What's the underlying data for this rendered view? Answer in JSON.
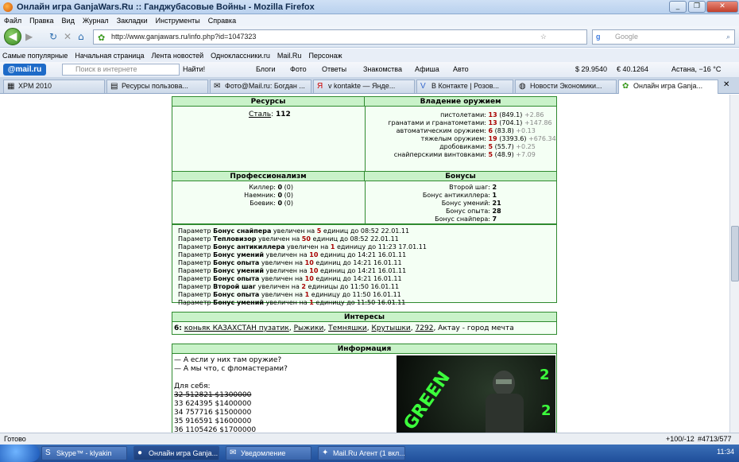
{
  "window": {
    "title": "Онлайн игра GanjaWars.Ru :: Ганджубасовые Войны - Mozilla Firefox"
  },
  "menu": [
    "Файл",
    "Правка",
    "Вид",
    "Журнал",
    "Закладки",
    "Инструменты",
    "Справка"
  ],
  "nav": {
    "url": "http://www.ganjawars.ru/info.php?id=1047323",
    "search_placeholder": "Google"
  },
  "bookmarks": [
    "Самые популярные",
    "Начальная страница",
    "Лента новостей",
    "Одноклассники.ru",
    "Mail.Ru",
    "Персонаж"
  ],
  "mailbar": {
    "logo": "@mail.ru",
    "search_placeholder": "Поиск в интернете",
    "find": "Найти!",
    "items": [
      "Блоги",
      "Фото",
      "Ответы",
      "Знакомства",
      "Афиша",
      "Авто"
    ],
    "usd": "$ 29.9540",
    "eur": "€ 40.1264",
    "weather": "Астана, −16 °C"
  },
  "tabs": [
    {
      "label": "XPM 2010",
      "icon": "grid-icon"
    },
    {
      "label": "Ресурсы пользова...",
      "icon": "page-icon"
    },
    {
      "label": "Фото@Mail.ru: Богдан ...",
      "icon": "mail-icon"
    },
    {
      "label": "v kontakte — Янде...",
      "icon": "yandex-icon"
    },
    {
      "label": "В Контакте | Розов...",
      "icon": "vk-icon"
    },
    {
      "label": "Новости Экономики...",
      "icon": "globe-icon"
    },
    {
      "label": "Онлайн игра Ganja...",
      "icon": "leaf-icon"
    }
  ],
  "resources": {
    "title": "Ресурсы",
    "steel_label": "Сталь",
    "steel_value": "112"
  },
  "weapons": {
    "title": "Владение оружием",
    "rows": [
      {
        "label": "пистолетами:",
        "level": "13",
        "exp": "(849.1)",
        "delta": "+2.86"
      },
      {
        "label": "гранатами и гранатометами:",
        "level": "13",
        "exp": "(704.1)",
        "delta": "+147.86"
      },
      {
        "label": "автоматическим оружием:",
        "level": "6",
        "exp": "(83.8)",
        "delta": "+0.13"
      },
      {
        "label": "тяжелым оружием:",
        "level": "19",
        "exp": "(3393.6)",
        "delta": "+676.34"
      },
      {
        "label": "дробовиками:",
        "level": "5",
        "exp": "(55.7)",
        "delta": "+0.25"
      },
      {
        "label": "снайперскими винтовками:",
        "level": "5",
        "exp": "(48.9)",
        "delta": "+7.09"
      }
    ]
  },
  "professions": {
    "title": "Профессионализм",
    "rows": [
      {
        "label": "Киллер:",
        "value": "0",
        "extra": "(0)"
      },
      {
        "label": "Наемник:",
        "value": "0",
        "extra": "(0)"
      },
      {
        "label": "Боевик:",
        "value": "0",
        "extra": "(0)"
      }
    ]
  },
  "bonuses": {
    "title": "Бонусы",
    "rows": [
      {
        "label": "Второй шаг:",
        "value": "2"
      },
      {
        "label": "Бонус антикиллера:",
        "value": "1"
      },
      {
        "label": "Бонус умений:",
        "value": "21"
      },
      {
        "label": "Бонус опыта:",
        "value": "28"
      },
      {
        "label": "Бонус снайпера:",
        "value": "7"
      }
    ]
  },
  "log": [
    {
      "pre": "Параметр",
      "param": "Бонус снайпера",
      "mid": "увеличен на",
      "amount": "5",
      "post": "единиц до 08:52 22.01.11"
    },
    {
      "pre": "Параметр",
      "param": "Тепловизор",
      "mid": "увеличен на",
      "amount": "50",
      "post": "единиц до 08:52 22.01.11"
    },
    {
      "pre": "Параметр",
      "param": "Бонус антикиллера",
      "mid": "увеличен на",
      "amount": "1",
      "post": "единицу до 11:23 17.01.11"
    },
    {
      "pre": "Параметр",
      "param": "Бонус умений",
      "mid": "увеличен на",
      "amount": "10",
      "post": "единиц до 14:21 16.01.11"
    },
    {
      "pre": "Параметр",
      "param": "Бонус опыта",
      "mid": "увеличен на",
      "amount": "10",
      "post": "единиц до 14:21 16.01.11"
    },
    {
      "pre": "Параметр",
      "param": "Бонус умений",
      "mid": "увеличен на",
      "amount": "10",
      "post": "единиц до 14:21 16.01.11"
    },
    {
      "pre": "Параметр",
      "param": "Бонус опыта",
      "mid": "увеличен на",
      "amount": "10",
      "post": "единиц до 14:21 16.01.11"
    },
    {
      "pre": "Параметр",
      "param": "Второй шаг",
      "mid": "увеличен на",
      "amount": "2",
      "post": "единицы до 11:50 16.01.11"
    },
    {
      "pre": "Параметр",
      "param": "Бонус опыта",
      "mid": "увеличен на",
      "amount": "1",
      "post": "единицу до 11:50 16.01.11"
    },
    {
      "pre": "Параметр",
      "param": "Бонус умений",
      "mid": "увеличен на",
      "amount": "1",
      "post": "единицу до 11:50 16.01.11"
    }
  ],
  "interests": {
    "title": "Интересы",
    "count": "6:",
    "links": [
      "коньяк КАЗАХСТАН пузатик",
      "Рыжики",
      "Темняшки",
      "Крутышки",
      "7292"
    ],
    "tail": "Актау - город мечта"
  },
  "info": {
    "title": "Информация",
    "lines": [
      "— А если у них там оружие?",
      "— А мы что, с фломастерами?"
    ],
    "for_self": "Для себя:",
    "struck": "32 512821 $1300000",
    "list": [
      "33 624395 $1400000",
      "34 757716 $1500000",
      "35 916591 $1600000",
      "36 1105426 $1700000"
    ],
    "image_text": "GREEN"
  },
  "status": {
    "text": "Готово",
    "zoom": "+100/-12",
    "counter": "#4713/577"
  },
  "taskbar": {
    "tasks": [
      "Skype™ - klyakin",
      "Онлайн игра Ganja...",
      "Уведомление",
      "Mail.Ru Агент (1 вкл..."
    ],
    "clock": "11:34"
  }
}
